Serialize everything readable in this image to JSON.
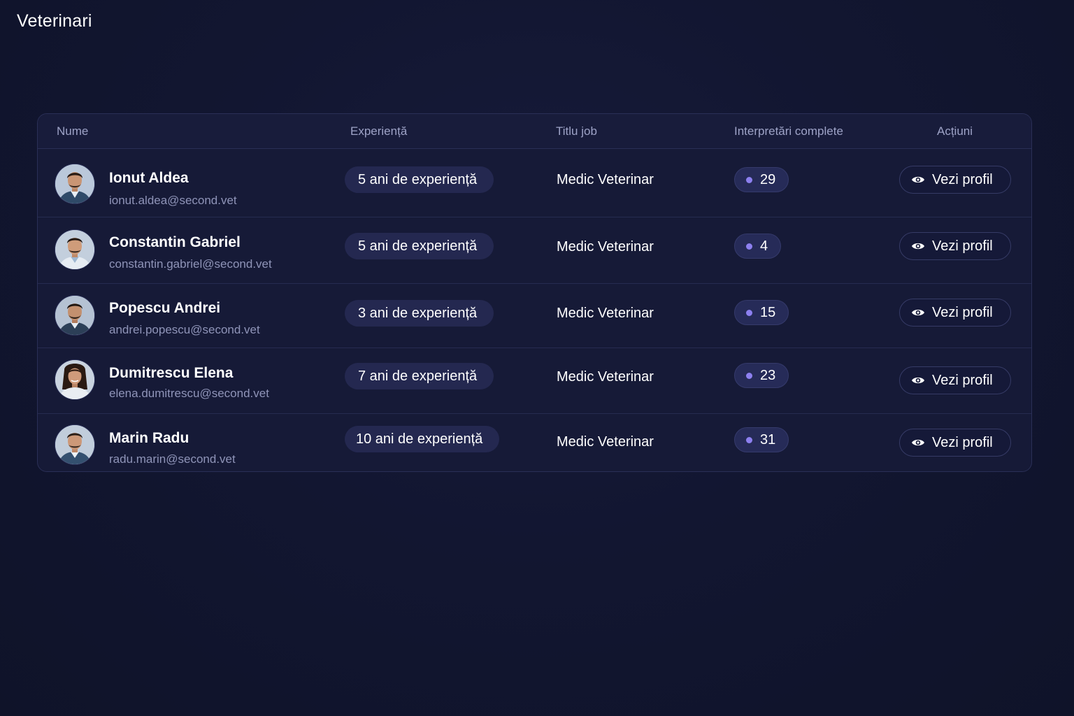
{
  "page": {
    "title": "Veterinari"
  },
  "table": {
    "columns": {
      "name": "Nume",
      "experience": "Experiență",
      "job": "Titlu job",
      "completed": "Interpretări complete",
      "actions": "Acțiuni"
    },
    "rows": [
      {
        "name": "Ionut Aldea",
        "email": "ionut.aldea@second.vet",
        "experience": "5 ani de experiență",
        "job": "Medic Veterinar",
        "completed": "29",
        "action_label": "Vezi profil",
        "avatar_icon": "male-avatar-icon"
      },
      {
        "name": "Constantin Gabriel",
        "email": "constantin.gabriel@second.vet",
        "experience": "5 ani de experiență",
        "job": "Medic Veterinar",
        "completed": "4",
        "action_label": "Vezi profil",
        "avatar_icon": "male-avatar-icon"
      },
      {
        "name": "Popescu Andrei",
        "email": "andrei.popescu@second.vet",
        "experience": "3 ani de experiență",
        "job": "Medic Veterinar",
        "completed": "15",
        "action_label": "Vezi profil",
        "avatar_icon": "male-avatar-icon"
      },
      {
        "name": "Dumitrescu Elena",
        "email": "elena.dumitrescu@second.vet",
        "experience": "7 ani de experiență",
        "job": "Medic Veterinar",
        "completed": "23",
        "action_label": "Vezi profil",
        "avatar_icon": "female-avatar-icon"
      },
      {
        "name": "Marin Radu",
        "email": "radu.marin@second.vet",
        "experience": "10 ani de experiență",
        "job": "Medic Veterinar",
        "completed": "31",
        "action_label": "Vezi profil",
        "avatar_icon": "male-avatar-icon"
      }
    ]
  },
  "colors": {
    "background": "#121630",
    "card": "#161a37",
    "border": "#2a2f56",
    "pill": "#242850",
    "accent_dot": "#8d80f0",
    "muted_text": "#8f94b8"
  }
}
